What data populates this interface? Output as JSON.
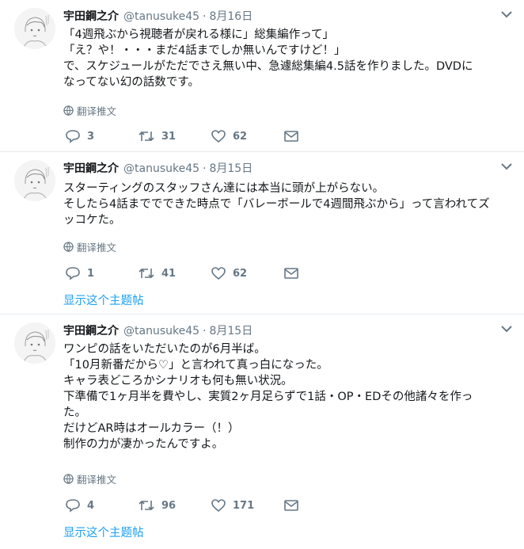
{
  "tweets": [
    {
      "name": "宇田鋼之介",
      "handle": "@tanusuke45",
      "sep": "·",
      "date": "8月16日",
      "lines": [
        "「4週飛ぶから視聴者が戻れる様に」総集編作って」",
        "「え？や！・・・まだ4話までしか無いんですけど！」",
        "で、スケジュールがただでさえ無い中、急遽総集編4.5話を作りました。DVDに",
        "なってない幻の話数です。"
      ],
      "translate": "翻译推文",
      "replies": "3",
      "retweets": "31",
      "likes": "62"
    },
    {
      "name": "宇田鋼之介",
      "handle": "@tanusuke45",
      "sep": "·",
      "date": "8月15日",
      "lines": [
        "スターティングのスタッフさん達には本当に頭が上がらない。",
        "そしたら4話まででできた時点で「バレーボールで4週間飛ぶから」って言われてズ",
        "ッコケた。"
      ],
      "translate": "翻译推文",
      "replies": "1",
      "retweets": "41",
      "likes": "62",
      "thread": "显示这个主题帖"
    },
    {
      "name": "宇田鋼之介",
      "handle": "@tanusuke45",
      "sep": "·",
      "date": "8月15日",
      "lines": [
        "ワンピの話をいただいたのが6月半ば。",
        "「10月新番だから♡」と言われて真っ白になった。",
        "キャラ表どころかシナリオも何も無い状況。",
        "下準備で1ヶ月半を費やし、実質2ヶ月足らずで1話・OP・EDその他諸々を作っ",
        "た。",
        "だけどAR時はオールカラー（！）",
        "制作の力が凄かったんですよ。"
      ],
      "translate": "翻译推文",
      "replies": "4",
      "retweets": "96",
      "likes": "171",
      "thread": "显示这个主题帖"
    }
  ],
  "colors": {
    "text": "#14171a",
    "muted": "#657786",
    "link": "#1da1f2",
    "divider": "#e6ecf0"
  },
  "icons": [
    "avatar-sketch",
    "caret-down-icon",
    "globe-icon",
    "reply-icon",
    "retweet-icon",
    "like-icon",
    "dm-icon"
  ]
}
